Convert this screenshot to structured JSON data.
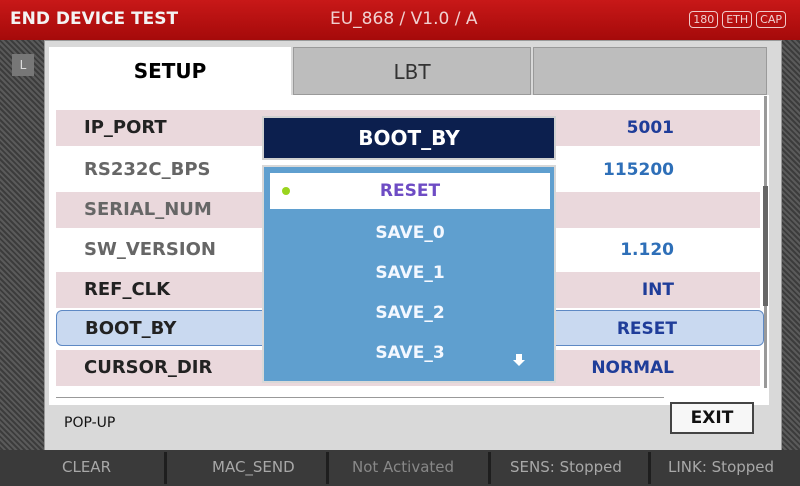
{
  "titlebar": {
    "title": "END DEVICE TEST",
    "subtitle": "EU_868 / V1.0 / A",
    "badges": [
      "180",
      "ETH",
      "CAP"
    ]
  },
  "tabs": [
    {
      "label": "SETUP",
      "active": true
    },
    {
      "label": "LBT",
      "active": false
    },
    {
      "label": "",
      "active": false
    }
  ],
  "rows": [
    {
      "label": "IP_PORT",
      "value": "5001"
    },
    {
      "label": "RS232C_BPS",
      "value": "115200"
    },
    {
      "label": "SERIAL_NUM",
      "value": ""
    },
    {
      "label": "SW_VERSION",
      "value": "1.120"
    },
    {
      "label": "REF_CLK",
      "value": "INT"
    },
    {
      "label": "BOOT_BY",
      "value": "RESET",
      "selected": true
    },
    {
      "label": "CURSOR_DIR",
      "value": "NORMAL"
    }
  ],
  "popup": {
    "title": "BOOT_BY",
    "options": [
      "RESET",
      "SAVE_0",
      "SAVE_1",
      "SAVE_2",
      "SAVE_3"
    ],
    "selected": "RESET"
  },
  "footer": {
    "mode_label": "POP-UP",
    "exit_label": "EXIT"
  },
  "statusbar": {
    "clear": "CLEAR",
    "mac_send": "MAC_SEND",
    "activation": "Not Activated",
    "sens": "SENS: Stopped",
    "link": "LINK: Stopped"
  },
  "side": {
    "left_key": "L"
  }
}
